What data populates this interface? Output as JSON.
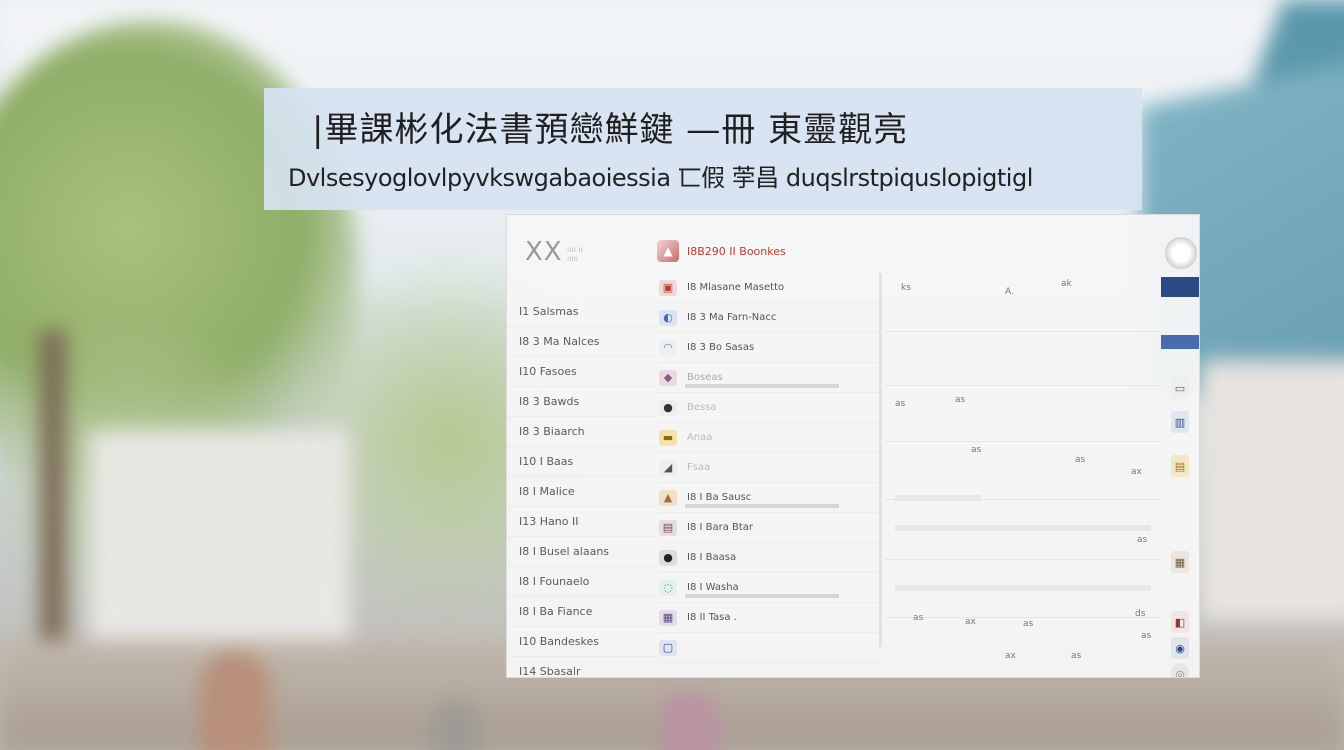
{
  "banner": {
    "headline": "|畢課彬化法書預戀鮮鍵 —冊 東靈觀亮",
    "subline": "Dvlsesyoglovlpyvkswgabaoiessia 匸假 荢昌 duqslrstpiquslopigtigl"
  },
  "app": {
    "logo": "XX",
    "logo_sub": "ıııı ıı\nııııı",
    "header_title": "I8B290 II Boonkes"
  },
  "sidebar": {
    "items": [
      "I1 Salsmas",
      "I8 3 Ma Nalces",
      "I10 Fasoes",
      "I8 3 Bawds",
      "I8 3 Biaarch",
      "I10 I Baas",
      "I8 I Malice",
      "I13 Hano II",
      "I8 I Busel alaans",
      "I8 I Founaelo",
      "I8 I Ba Fiance",
      "I10 Bandeskes",
      "I14 Sbasalr"
    ]
  },
  "list": {
    "rows": [
      {
        "icon": "▣",
        "label": "I8 Mlasane Masetto"
      },
      {
        "icon": "◐",
        "label": "I8 3 Ma Farn-Nacc"
      },
      {
        "icon": "◠",
        "label": "I8 3 Bo Sasas"
      },
      {
        "icon": "◆",
        "label": "Boseas"
      },
      {
        "icon": "●",
        "label": "Bessa"
      },
      {
        "icon": "▬",
        "label": "Anaa"
      },
      {
        "icon": "◢",
        "label": "Fsaa"
      },
      {
        "icon": "▲",
        "label": "I8 I Ba Sausc"
      },
      {
        "icon": "▤",
        "label": "I8 I Bara Btar"
      },
      {
        "icon": "●",
        "label": "I8 I Baasa"
      },
      {
        "icon": "◌",
        "label": "I8 I Washa"
      },
      {
        "icon": "▦",
        "label": "I8 II Tasa ."
      },
      {
        "icon": "▢",
        "label": ""
      }
    ]
  },
  "detail": {
    "marks": [
      "ks",
      "A.",
      "ak",
      "as",
      "as",
      "as",
      "as",
      "ax",
      "as",
      "as",
      "ax",
      "ax",
      "as",
      "ds",
      "as",
      "as"
    ]
  },
  "colors": {
    "banner_bg": "#d6e3f1",
    "accent_red": "#c0392b",
    "rail_blue": "#2c4a85"
  }
}
